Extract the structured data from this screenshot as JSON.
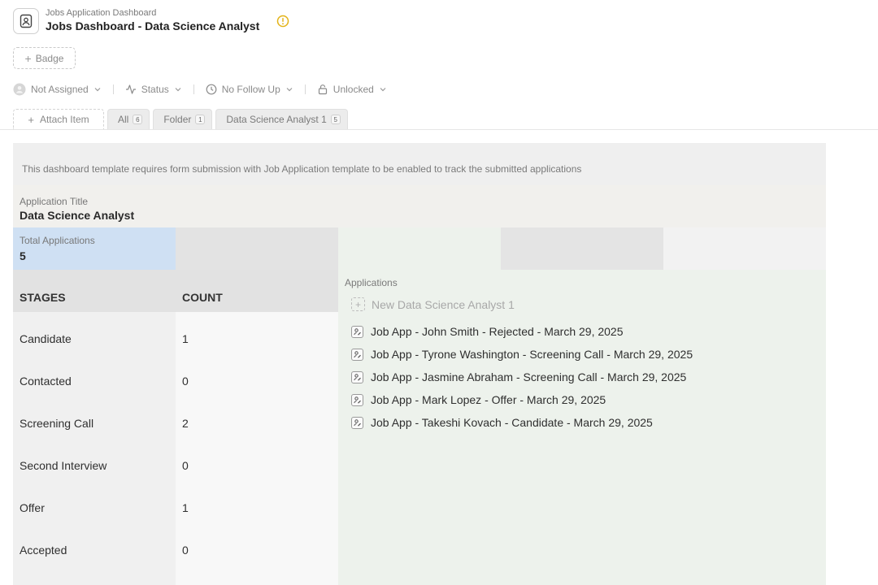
{
  "header": {
    "breadcrumb": "Jobs Application Dashboard",
    "title": "Jobs Dashboard - Data Science Analyst",
    "icons": {
      "app": "contact-card-icon",
      "warning": "warning-circle-icon"
    },
    "warning_color": "#e3b318"
  },
  "badge": {
    "label": "Badge"
  },
  "properties": {
    "assignee": "Not Assigned",
    "status": "Status",
    "follow_up": "No Follow Up",
    "lock": "Unlocked"
  },
  "tabs": {
    "attach_label": "Attach Item",
    "items": [
      {
        "label": "All",
        "count": "6"
      },
      {
        "label": "Folder",
        "count": "1"
      },
      {
        "label": "Data Science Analyst 1",
        "count": "5"
      }
    ]
  },
  "dashboard": {
    "notice": "This dashboard template requires form submission with Job Application template to be enabled to track the submitted applications",
    "application_title_label": "Application Title",
    "application_title": "Data Science Analyst",
    "total_label": "Total Applications",
    "total_value": "5",
    "stages_header": "STAGES",
    "count_header": "COUNT",
    "stages": [
      {
        "name": "Candidate",
        "count": "1"
      },
      {
        "name": "Contacted",
        "count": "0"
      },
      {
        "name": "Screening Call",
        "count": "2"
      },
      {
        "name": "Second Interview",
        "count": "0"
      },
      {
        "name": "Offer",
        "count": "1"
      },
      {
        "name": "Accepted",
        "count": "0"
      }
    ],
    "applications_label": "Applications",
    "new_item_label": "New Data Science Analyst 1",
    "applications": [
      "Job App - John Smith - Rejected - March 29, 2025",
      "Job App - Tyrone Washington - Screening Call - March 29, 2025",
      "Job App - Jasmine Abraham - Screening Call - March 29, 2025",
      "Job App - Mark Lopez - Offer - March 29, 2025",
      "Job App - Takeshi Kovach - Candidate - March 29, 2025"
    ],
    "colors": {
      "total_cell": "#cfe0f3",
      "applications_panel": "#edf2ec"
    }
  }
}
